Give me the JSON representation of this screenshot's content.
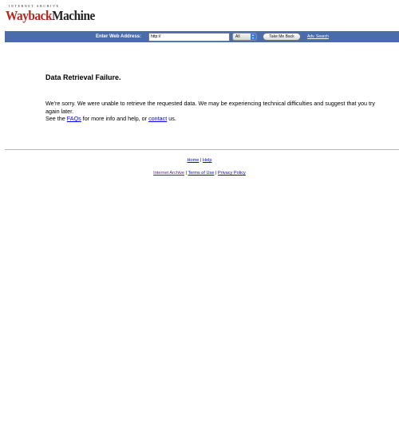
{
  "logo": {
    "top_text": "INTERNET ARCHIVE",
    "word1": "Wayback",
    "word2": "Machine"
  },
  "search_bar": {
    "label": "Enter Web Address:",
    "url_value": "http://",
    "scope_selected": "All",
    "submit_label": "Take Me Back",
    "advanced_link": "Adv. Search",
    "color": "#4b6cab"
  },
  "error": {
    "title": "Data Retrieval Failure.",
    "line1": "We're sorry. We were unable to retrieve the requested data. We may be experiencing technical difficulties and suggest that you try again later.",
    "line2_prefix": "See the",
    "faq_link": "FAQs",
    "line2_middle": "for more info and help, or",
    "contact_link": "contact",
    "line2_suffix": "us."
  },
  "footer": {
    "home": "Home",
    "help": "Help",
    "separator": "|",
    "internet_archive": "Internet Archive",
    "terms": "Terms of Use",
    "privacy": "Privacy Policy"
  }
}
